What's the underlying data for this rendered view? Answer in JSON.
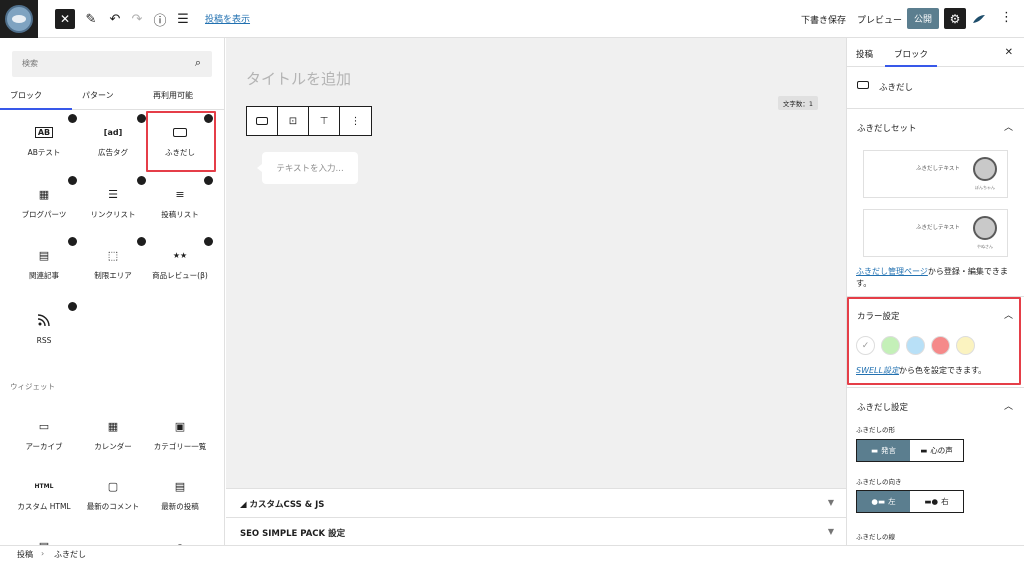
{
  "topbar": {
    "view_post_link": "投稿を表示",
    "save_draft": "下書き保存",
    "preview": "プレビュー",
    "publish": "公開"
  },
  "inserter": {
    "search_placeholder": "検索",
    "tabs": [
      "ブロック",
      "パターン",
      "再利用可能"
    ],
    "blocks": [
      {
        "label": "ABテスト",
        "icon": "AB"
      },
      {
        "label": "広告タグ",
        "icon": "[ad]"
      },
      {
        "label": "ふきだし",
        "icon": "▭"
      },
      {
        "label": "ブログパーツ",
        "icon": "▦"
      },
      {
        "label": "リンクリスト",
        "icon": "☰"
      },
      {
        "label": "投稿リスト",
        "icon": "≡"
      },
      {
        "label": "関連記事",
        "icon": "▤"
      },
      {
        "label": "制限エリア",
        "icon": "⬚"
      },
      {
        "label": "商品レビュー(β)",
        "icon": "★★"
      },
      {
        "label": "RSS",
        "icon": "◟"
      }
    ],
    "widgets_heading": "ウィジェット",
    "widgets": [
      {
        "label": "アーカイブ",
        "icon": "▭"
      },
      {
        "label": "カレンダー",
        "icon": "▦"
      },
      {
        "label": "カテゴリー一覧",
        "icon": "▣"
      },
      {
        "label": "カスタム HTML",
        "icon": "HTML"
      },
      {
        "label": "最新のコメント",
        "icon": "▢"
      },
      {
        "label": "最新の投稿",
        "icon": "▤"
      }
    ]
  },
  "editor": {
    "title_placeholder": "タイトルを追加",
    "word_count": "文字数：1",
    "text_placeholder": "テキストを入力..."
  },
  "metaboxes": [
    {
      "label": "カスタムCSS & JS"
    },
    {
      "label": "SEO SIMPLE PACK 設定"
    }
  ],
  "sidebar": {
    "tabs": [
      "投稿",
      "ブロック"
    ],
    "block_name": "ふきだし",
    "fukidashi_set_title": "ふきだしセット",
    "fukidashi_cards": [
      {
        "text": "ふきだしテキスト",
        "name": "ぽんちゃん"
      },
      {
        "text": "ふきだしテキスト",
        "name": "やぬさん"
      }
    ],
    "manage_link": "ふきだし管理ページ",
    "manage_suffix": "から登録・編集できます。",
    "color_title": "カラー設定",
    "colors": [
      "#ffffff",
      "#c4f0b8",
      "#b8e0f7",
      "#f58a8a",
      "#fbf3c0"
    ],
    "swell_link": "SWELL設定",
    "swell_suffix": "から色を設定できます。",
    "fukidashi_settings_title": "ふきだし設定",
    "shape_label": "ふきだしの形",
    "shape_options": [
      "発言",
      "心の声"
    ],
    "direction_label": "ふきだしの向き",
    "direction_options": [
      "左",
      "右"
    ],
    "line_label": "ふきだしの線"
  },
  "footer": {
    "crumbs": [
      "投稿",
      "ふきだし"
    ]
  },
  "colors": {
    "highlight": "#e53e48",
    "accent": "#5b7e8f",
    "link": "#2271b1"
  }
}
